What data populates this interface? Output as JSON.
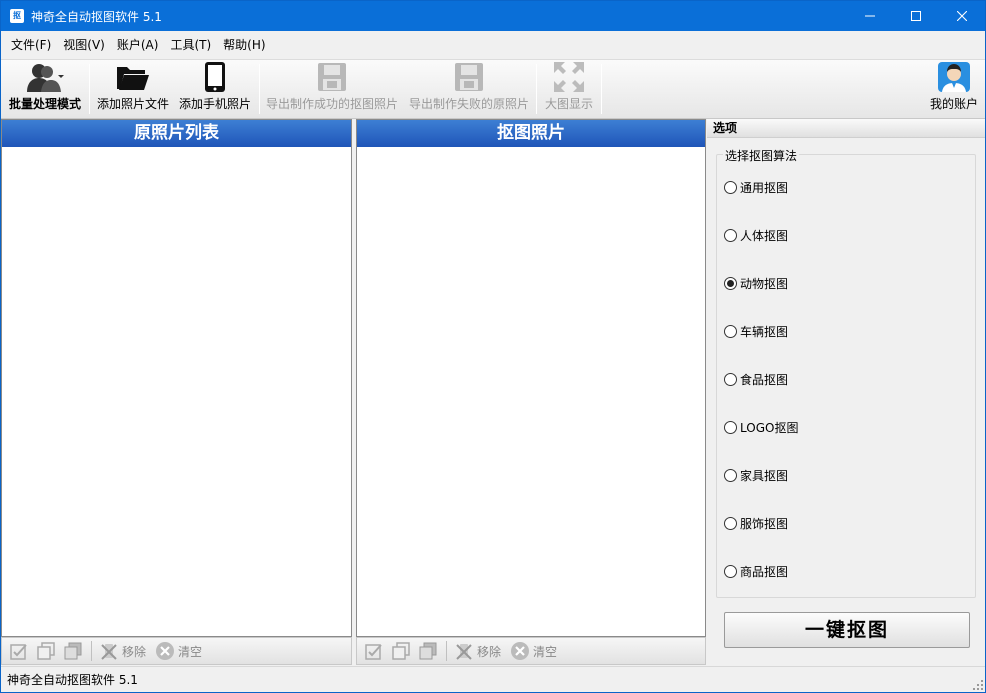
{
  "window": {
    "title": "神奇全自动抠图软件 5.1",
    "app_icon_text": "抠"
  },
  "menu": [
    "文件(F)",
    "视图(V)",
    "账户(A)",
    "工具(T)",
    "帮助(H)"
  ],
  "toolbar": {
    "batch": "批量处理模式",
    "add_file": "添加照片文件",
    "add_phone": "添加手机照片",
    "export_ok": "导出制作成功的抠图照片",
    "export_fail": "导出制作失败的原照片",
    "big_view": "大图显示",
    "account": "我的账户"
  },
  "left_panel": {
    "title": "原照片列表",
    "remove": "移除",
    "clear": "清空"
  },
  "mid_panel": {
    "title": "抠图照片",
    "remove": "移除",
    "clear": "清空"
  },
  "options": {
    "header": "选项",
    "group_title": "选择抠图算法",
    "algorithms": [
      "通用抠图",
      "人体抠图",
      "动物抠图",
      "车辆抠图",
      "食品抠图",
      "LOGO抠图",
      "家具抠图",
      "服饰抠图",
      "商品抠图"
    ],
    "selected": "动物抠图",
    "action": "一键抠图"
  },
  "status": {
    "text": "神奇全自动抠图软件 5.1"
  }
}
